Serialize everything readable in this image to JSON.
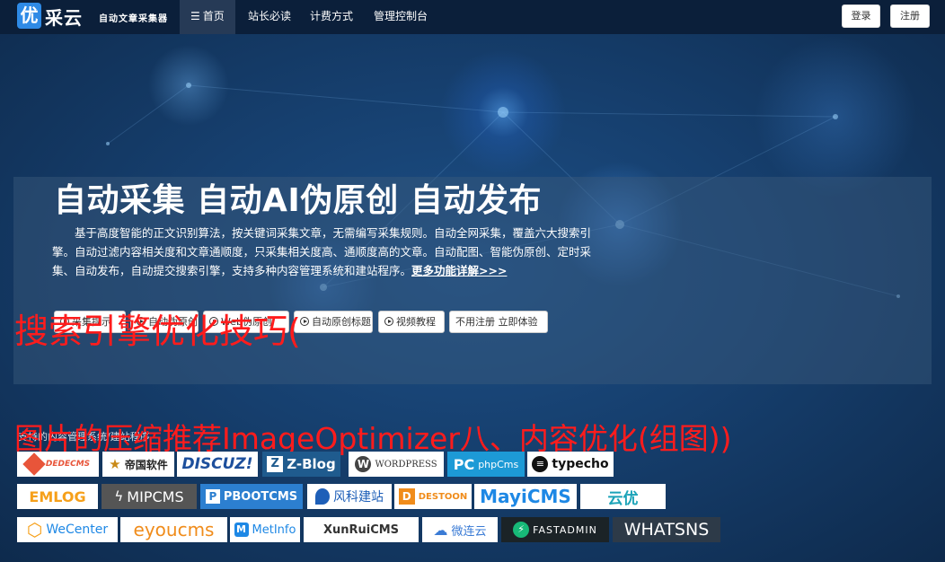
{
  "navbar": {
    "logo_char": "优",
    "logo_text": "采云",
    "logo_subtitle": "自动文章采集器",
    "items": [
      {
        "label": "首页",
        "active": true
      },
      {
        "label": "站长必读",
        "active": false
      },
      {
        "label": "计费方式",
        "active": false
      },
      {
        "label": "管理控制台",
        "active": false
      }
    ],
    "login_label": "登录",
    "register_label": "注册"
  },
  "hero": {
    "title": "自动采集 自动AI伪原创 自动发布",
    "description": "基于高度智能的正文识别算法，按关键词采集文章，无需编写采集规则。自动全网采集，覆盖六大搜索引擎。自动过滤内容相关度和文章通顺度，只采集相关度高、通顺度高的文章。自动配图、智能伪原创、定时采集、自动发布，自动提交搜索引擎，支持多种内容管理系统和建站程序。",
    "more_link": "更多功能详解>>>",
    "buttons": [
      {
        "label": "采集提示"
      },
      {
        "label": "自动伪原创"
      },
      {
        "label": "Web伪原创"
      },
      {
        "label": "自动原创标题"
      },
      {
        "label": "视频教程"
      },
      {
        "label": "不用注册 立即体验"
      }
    ]
  },
  "overlays": {
    "line1": "搜索引擎优化技巧(",
    "line2": "图片的压缩推荐ImageOptimizer八、内容优化(组图))"
  },
  "support_label": "支持的内容管理系统/建站程序",
  "cms_logos": [
    {
      "name": "DEDECMS",
      "color": "#e8553a"
    },
    {
      "name": "帝国软件",
      "color": "#c98a17"
    },
    {
      "name": "DISCUZ!",
      "color": "#1d4f9c"
    },
    {
      "name": "Z-Blog",
      "color": "#ffffff"
    },
    {
      "name": "WORDPRESS",
      "color": "#333333"
    },
    {
      "name": "phpCms",
      "color": "#ffffff"
    },
    {
      "name": "typecho",
      "color": "#111111"
    },
    {
      "name": "EMLOG",
      "color": "#f6a01a"
    },
    {
      "name": "MIPCMS",
      "color": "#ffffff"
    },
    {
      "name": "PBOOTCMS",
      "color": "#ffffff"
    },
    {
      "name": "风科建站",
      "color": "#1e5fb8"
    },
    {
      "name": "DESTOON",
      "color": "#f08c1b"
    },
    {
      "name": "MayiCMS",
      "color": "#1e88e5"
    },
    {
      "name": "云优",
      "color": "#1ba3b8"
    },
    {
      "name": "WeCenter",
      "color": "#1e88e5"
    },
    {
      "name": "eyoucms",
      "color": "#f08c1b"
    },
    {
      "name": "MetInfo",
      "color": "#1e88e5"
    },
    {
      "name": "XunRuiCMS",
      "color": "#333333"
    },
    {
      "name": "微连云",
      "color": "#3a7bd5"
    },
    {
      "name": "FASTADMIN",
      "color": "#ffffff"
    },
    {
      "name": "WHATSNS",
      "color": "#ffffff"
    }
  ]
}
